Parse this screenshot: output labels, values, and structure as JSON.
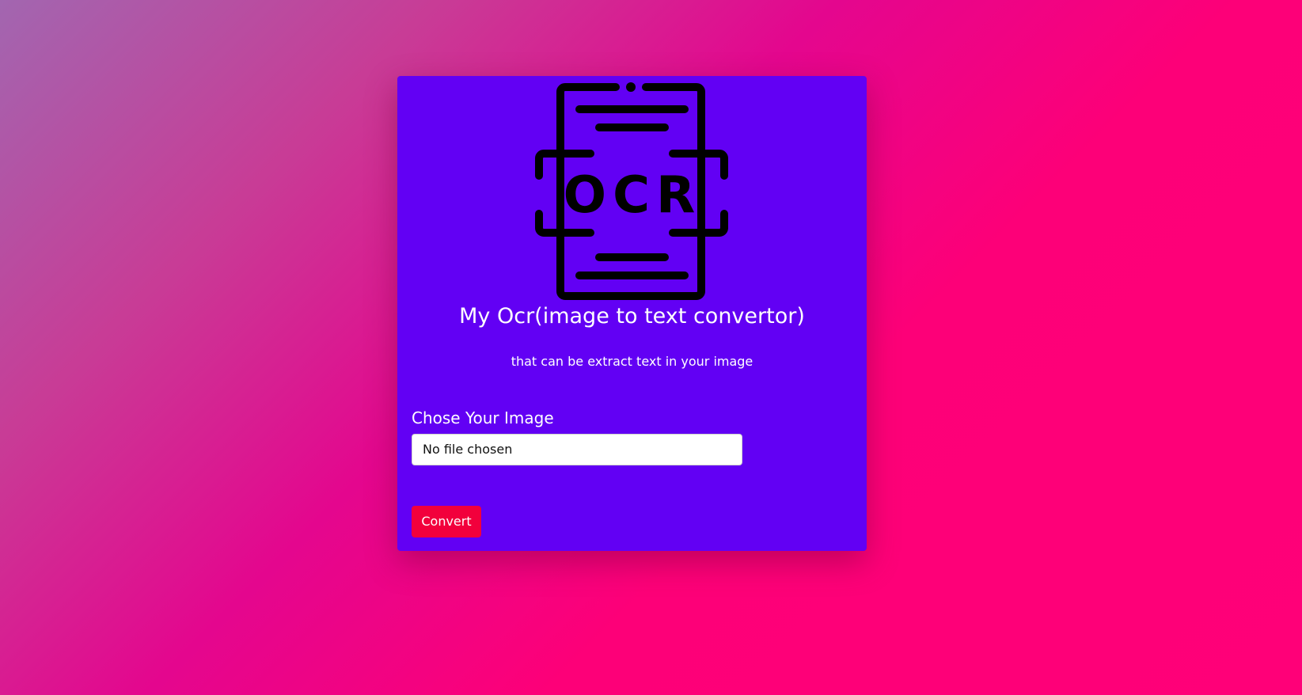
{
  "app": {
    "title": "My Ocr(image to text convertor)",
    "subtitle": "that can be extract text in your image"
  },
  "logo": {
    "icon": "ocr-document-scan-icon",
    "text": "OCR"
  },
  "form": {
    "label": "Chose Your Image",
    "file_input_value": "No file chosen",
    "convert_label": "Convert"
  },
  "colors": {
    "card_background": "#6200f4",
    "button_background": "#f2003c",
    "background_gradient_start": "#a266b0",
    "background_gradient_end": "#ff0078"
  }
}
